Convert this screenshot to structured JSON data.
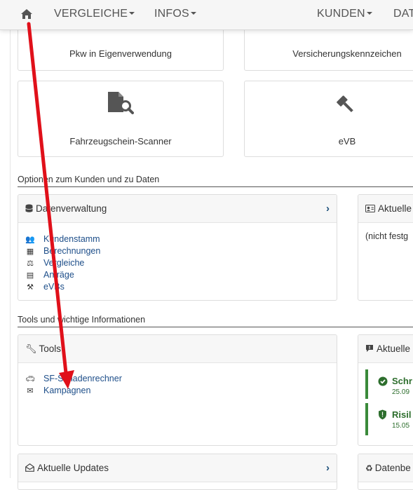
{
  "nav": {
    "home_icon": "home-icon",
    "vergleiche": "VERGLEICHE",
    "infos": "INFOS",
    "kunden": "KUNDEN",
    "dat": "DAT"
  },
  "tiles": {
    "pkw": "Pkw in Eigenverwendung",
    "kennzeichen": "Versicherungskennzeichen",
    "scanner": "Fahrzeugschein-Scanner",
    "evb": "eVB"
  },
  "sections": {
    "options": "Optionen zum Kunden und zu Daten",
    "tools": "Tools und wichtige Informationen"
  },
  "datenverwaltung": {
    "title": "Datenverwaltung",
    "items": [
      {
        "label": "Kundenstamm",
        "icon": "users-icon"
      },
      {
        "label": "Berechnungen",
        "icon": "calculator-icon"
      },
      {
        "label": "Vergleiche",
        "icon": "balance-icon"
      },
      {
        "label": "Anträge",
        "icon": "document-icon"
      },
      {
        "label": "eVBs",
        "icon": "gavel-icon"
      }
    ]
  },
  "aktueller": {
    "title": "Aktuelle",
    "body": "(nicht festg"
  },
  "tools": {
    "title": "Tools",
    "items": [
      {
        "label": "SF-Schadenrechner",
        "icon": "car-crash-icon"
      },
      {
        "label": "Kampagnen",
        "icon": "envelope-icon"
      }
    ]
  },
  "aktuelle2": {
    "title": "Aktuelle",
    "alerts": [
      {
        "title": "Schr",
        "date": "25.09"
      },
      {
        "title": "Risil",
        "date": "15.05"
      }
    ]
  },
  "updates": {
    "title": "Aktuelle Updates"
  },
  "datenbe": {
    "title": "Datenbe"
  },
  "colors": {
    "link": "#1d4e89",
    "accent_green": "#3a8a3a",
    "arrow": "#e0101a"
  }
}
